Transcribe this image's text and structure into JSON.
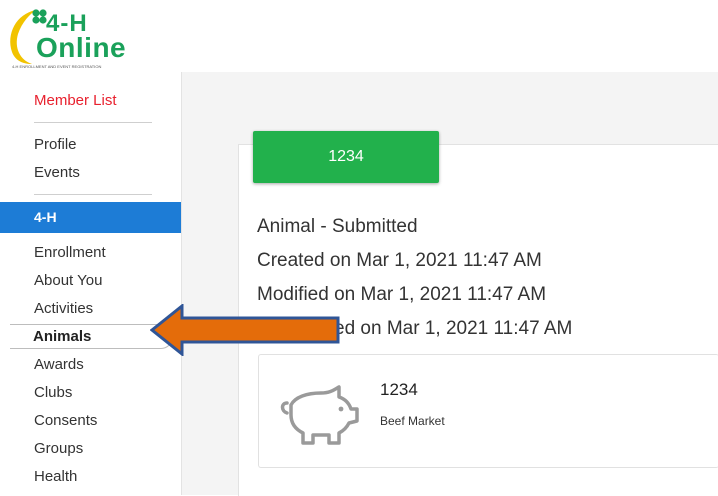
{
  "app": {
    "logo_top": "4-H",
    "logo_main": "Online",
    "logo_tagline": "4-H ENROLLMENT AND EVENT REGISTRATION"
  },
  "sidebar": {
    "member_list": "Member List",
    "profile": "Profile",
    "events": "Events",
    "section_label": "4-H",
    "items": [
      "Enrollment",
      "About You",
      "Activities",
      "Animals",
      "Awards",
      "Clubs",
      "Consents",
      "Groups",
      "Health"
    ],
    "active_item": "Animals"
  },
  "record": {
    "badge": "1234",
    "status": "Animal - Submitted",
    "created": "Created on Mar 1, 2021 11:47 AM",
    "modified": "Modified on Mar 1, 2021 11:47 AM",
    "submitted_visible": "ed on Mar 1, 2021 11:47 AM"
  },
  "animal_card": {
    "name": "1234",
    "type": "Beef Market",
    "icon": "pig-icon"
  },
  "colors": {
    "brand_green": "#1aa15a",
    "badge_green": "#22b14c",
    "section_blue": "#1d7cd6",
    "member_list_red": "#e8212e",
    "arrow_orange": "#e46c0a",
    "arrow_outline": "#2f5597"
  }
}
